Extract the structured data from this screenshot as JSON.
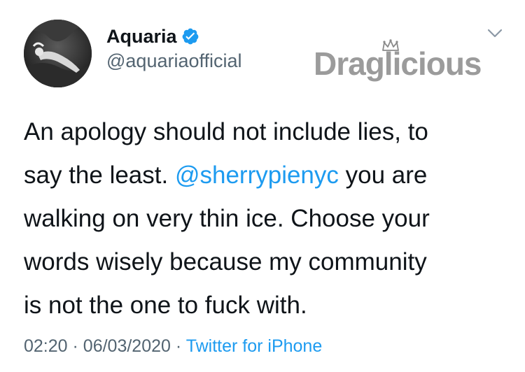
{
  "author": {
    "display_name": "Aquaria",
    "handle": "@aquariaofficial",
    "verified": true,
    "avatar_icon": "profile-photo"
  },
  "watermark": {
    "text": "Draglicious",
    "icon": "crown-icon"
  },
  "menu": {
    "icon": "chevron-down-icon"
  },
  "tweet": {
    "line1": "An apology should not include lies, to",
    "line2_pre": "say the least. ",
    "mention": "@sherrypienyc",
    "line2_post": " you are",
    "line3": "walking on very thin ice. Choose your",
    "line4": "words wisely because my community",
    "line5": "is not the one to fuck with."
  },
  "meta": {
    "time": "02:20",
    "separator": "·",
    "date": "06/03/2020",
    "source": "Twitter for iPhone"
  },
  "colors": {
    "link": "#1d9bf0",
    "secondary": "#536471",
    "text": "#0f1419"
  }
}
